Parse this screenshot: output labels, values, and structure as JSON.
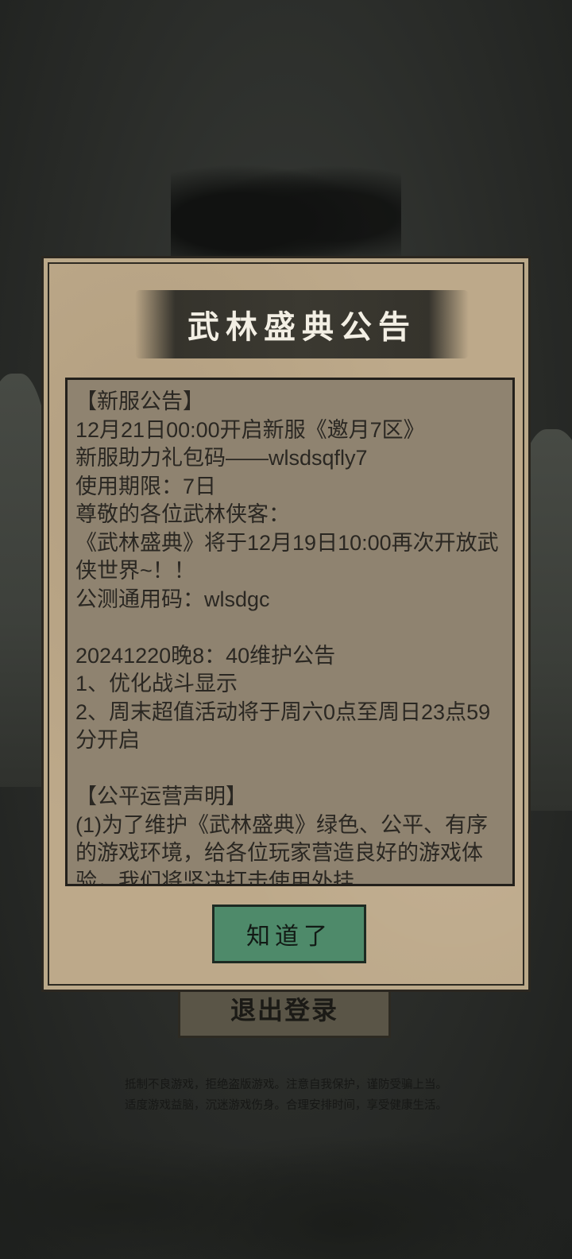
{
  "background": {
    "logout_label": "退出登录",
    "footer_line_1": "抵制不良游戏，拒绝盗版游戏。注意自我保护，谨防受骗上当。",
    "footer_line_2": "适度游戏益脑，沉迷游戏伤身。合理安排时间，享受健康生活。"
  },
  "modal": {
    "title": "武林盛典公告",
    "content": "【新服公告】\n12月21日00:00开启新服《邀月7区》\n新服助力礼包码——wlsdsqfly7\n使用期限：7日\n尊敬的各位武林侠客：\n《武林盛典》将于12月19日10:00再次开放武侠世界~！！\n公测通用码：wlsdgc\n\n20241220晚8：40维护公告\n1、优化战斗显示\n2、周末超值活动将于周六0点至周日23点59分开启\n\n【公平运营声明】\n(1)为了维护《武林盛典》绿色、公平、有序的游戏环境，给各位玩家营造良好的游戏体验，我们将坚决打击使用外挂",
    "ok_label": "知道了"
  },
  "colors": {
    "modal_bg": "#bda98a",
    "content_bg": "#8f8370",
    "ok_button": "#4e8a6a",
    "title_banner": "#3b3931"
  }
}
